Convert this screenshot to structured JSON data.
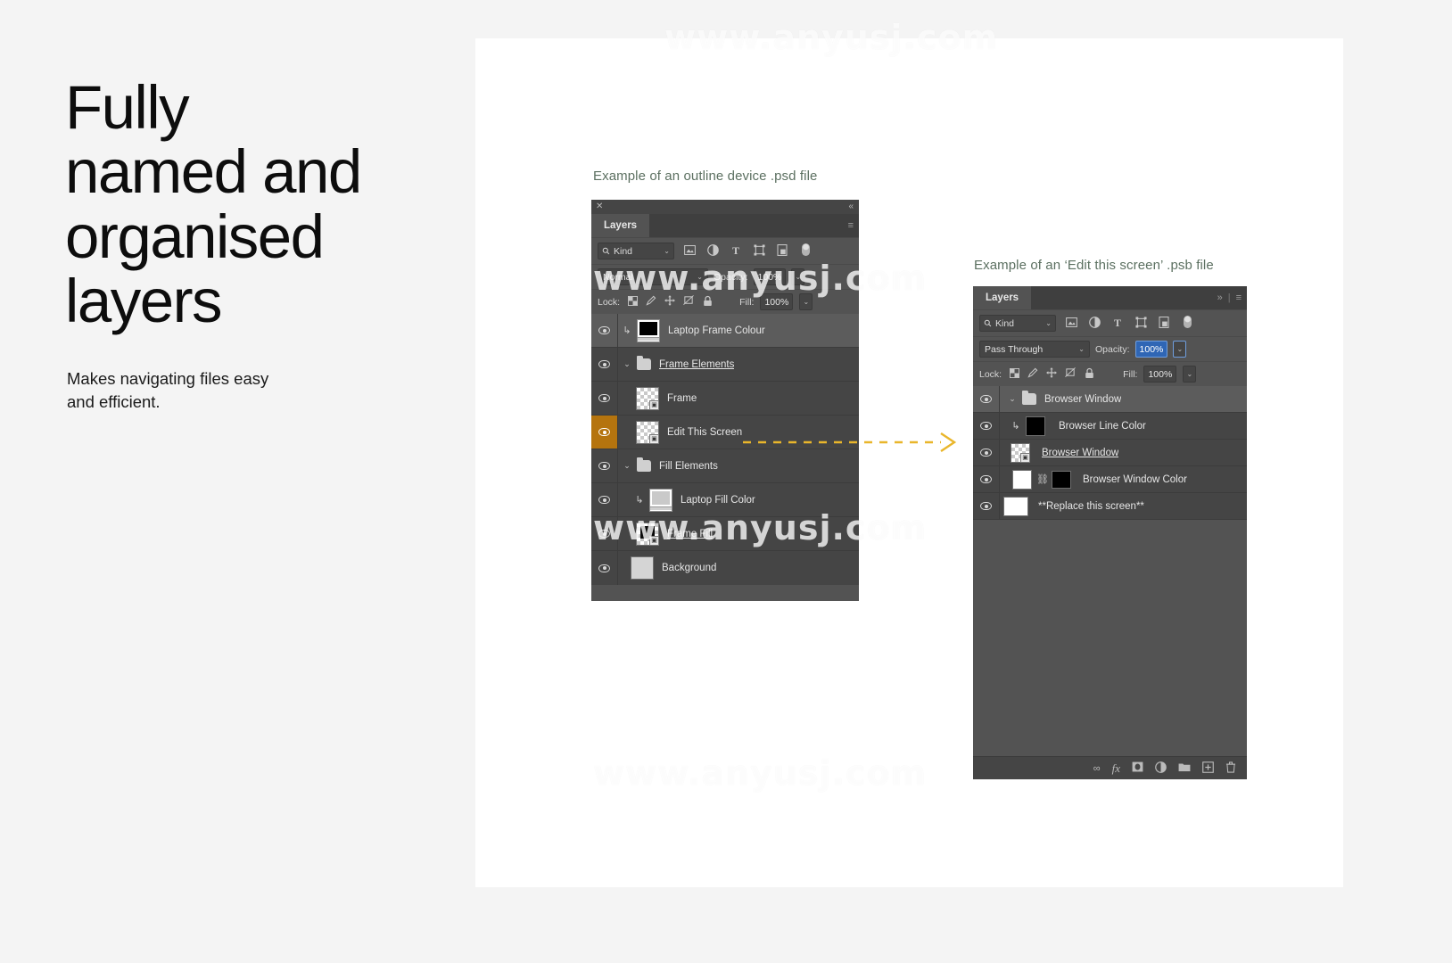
{
  "page": {
    "headline": "Fully\nnamed and\norganised\nlayers",
    "subcopy": "Makes navigating files easy\nand efficient.",
    "watermark": "www.anyusj.com",
    "accent_color": "#b5740e",
    "caption_color": "#5c7061",
    "panel_bg": "#535353",
    "row_bg": "#454545"
  },
  "left_example": {
    "caption": "Example of an outline device .psd file",
    "window": {
      "close_icon": "✕",
      "collapse_icon": "«"
    },
    "tab": {
      "label": "Layers",
      "menu_icon": "≡"
    },
    "filter": {
      "kind_label": "Kind",
      "search_icon": "search-icon",
      "chevron": "⌄",
      "icons": [
        "pixel-filter-icon",
        "adjustment-filter-icon",
        "type-filter-icon",
        "shape-filter-icon",
        "smart-object-filter-icon",
        "toggle-filter-icon"
      ]
    },
    "blend": {
      "mode": "Normal",
      "opacity_label": "Opacity:",
      "opacity_value": "100%",
      "chevron": "⌄"
    },
    "lock": {
      "label": "Lock:",
      "fill_label": "Fill:",
      "fill_value": "100%",
      "icons": [
        "lock-transparency-icon",
        "lock-image-icon",
        "lock-position-icon",
        "lock-artboard-icon",
        "lock-all-icon"
      ]
    },
    "layers": [
      {
        "name": "Laptop Frame Colour",
        "thumb": "laptop-black",
        "clipped": true,
        "group": false,
        "selected": true,
        "highlighted": false,
        "underline": false
      },
      {
        "name": "Frame Elements",
        "thumb": "folder",
        "clipped": false,
        "group": true,
        "selected": false,
        "highlighted": false,
        "underline": true
      },
      {
        "name": "Frame",
        "thumb": "checker-so",
        "clipped": false,
        "group": false,
        "selected": false,
        "highlighted": false,
        "underline": false
      },
      {
        "name": "Edit This Screen",
        "thumb": "checker-so",
        "clipped": false,
        "group": false,
        "selected": false,
        "highlighted": true,
        "underline": false
      },
      {
        "name": "Fill Elements",
        "thumb": "folder",
        "clipped": false,
        "group": true,
        "selected": false,
        "highlighted": false,
        "underline": false
      },
      {
        "name": "Laptop Fill Color",
        "thumb": "laptop-grey",
        "clipped": true,
        "group": false,
        "selected": false,
        "highlighted": false,
        "underline": false
      },
      {
        "name": "Frame Fill",
        "thumb": "checker-black",
        "clipped": false,
        "group": false,
        "selected": false,
        "highlighted": false,
        "underline": true
      },
      {
        "name": "Background",
        "thumb": "solid-grey",
        "clipped": false,
        "group": false,
        "selected": false,
        "highlighted": false,
        "underline": false
      }
    ]
  },
  "right_example": {
    "caption": "Example of an ‘Edit this screen’ .psb file",
    "tab": {
      "label": "Layers",
      "expand_icon": "»",
      "divider": "|",
      "menu_icon": "≡"
    },
    "filter": {
      "kind_label": "Kind",
      "search_icon": "search-icon",
      "chevron": "⌄",
      "icons": [
        "pixel-filter-icon",
        "adjustment-filter-icon",
        "type-filter-icon",
        "shape-filter-icon",
        "smart-object-filter-icon",
        "toggle-filter-icon"
      ]
    },
    "blend": {
      "mode": "Pass Through",
      "opacity_label": "Opacity:",
      "opacity_value": "100%",
      "chevron": "⌄"
    },
    "lock": {
      "label": "Lock:",
      "fill_label": "Fill:",
      "fill_value": "100%",
      "icons": [
        "lock-transparency-icon",
        "lock-image-icon",
        "lock-position-icon",
        "lock-artboard-icon",
        "lock-all-icon"
      ]
    },
    "layers": [
      {
        "name": "Browser Window",
        "thumb": "folder",
        "clipped": false,
        "group": true,
        "selected": true,
        "linked": false,
        "underline": false
      },
      {
        "name": "Browser Line Color",
        "thumb": "solid-black",
        "clipped": true,
        "group": false,
        "selected": false,
        "linked": false,
        "underline": false
      },
      {
        "name": "Browser Window",
        "thumb": "checker-so",
        "clipped": false,
        "group": false,
        "selected": false,
        "linked": false,
        "underline": true
      },
      {
        "name": "Browser Window Color",
        "thumb": "mask-black",
        "clipped": false,
        "group": false,
        "selected": false,
        "linked": true,
        "underline": false
      },
      {
        "name": "**Replace this screen**",
        "thumb": "solid-white",
        "clipped": false,
        "group": false,
        "selected": false,
        "linked": false,
        "underline": false
      }
    ],
    "footer_icons": [
      "link-icon",
      "fx-icon",
      "mask-icon",
      "adjustment-icon",
      "folder-icon",
      "new-layer-icon",
      "trash-icon"
    ],
    "footer_glyphs": [
      "∞",
      "fx",
      "▣",
      "◑",
      "🗀",
      "⊞",
      "🗑"
    ]
  }
}
